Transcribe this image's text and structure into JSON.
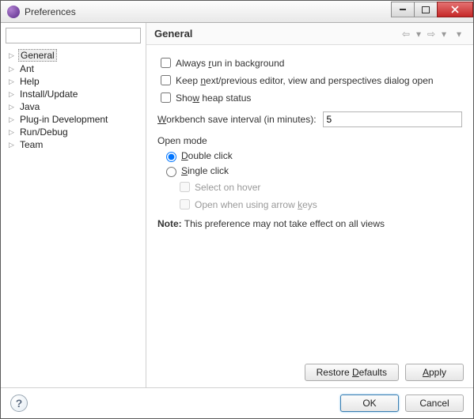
{
  "window": {
    "title": "Preferences"
  },
  "sidebar": {
    "filter_placeholder": "",
    "items": [
      {
        "label": "General",
        "expandable": true,
        "selected": true
      },
      {
        "label": "Ant",
        "expandable": true
      },
      {
        "label": "Help",
        "expandable": true
      },
      {
        "label": "Install/Update",
        "expandable": true
      },
      {
        "label": "Java",
        "expandable": true
      },
      {
        "label": "Plug-in Development",
        "expandable": true
      },
      {
        "label": "Run/Debug",
        "expandable": true
      },
      {
        "label": "Team",
        "expandable": true
      }
    ]
  },
  "page": {
    "title": "General",
    "checkboxes": {
      "run_bg": {
        "label_pre": "Always ",
        "mn": "r",
        "label_post": "un in background",
        "checked": false
      },
      "keep_editor": {
        "label_pre": "Keep ",
        "mn": "n",
        "label_post": "ext/previous editor, view and perspectives dialog open",
        "checked": false
      },
      "heap": {
        "label_pre": "Sho",
        "mn": "w",
        "label_post": " heap status",
        "checked": false
      }
    },
    "interval": {
      "label_pre": "",
      "mn": "W",
      "label_post": "orkbench save interval (in minutes):",
      "value": "5"
    },
    "open_mode": {
      "group": "Open mode",
      "double": {
        "mn": "D",
        "label": "ouble click",
        "checked": true
      },
      "single": {
        "mn": "S",
        "label": "ingle click",
        "checked": false
      },
      "hover": {
        "label": "Select on hover",
        "enabled": false
      },
      "arrow": {
        "label_pre": "Open when using arrow ",
        "mn": "k",
        "label_post": "eys",
        "enabled": false
      }
    },
    "note": {
      "bold": "Note:",
      "text": " This preference may not take effect on all views"
    },
    "buttons": {
      "restore_pre": "Restore ",
      "restore_mn": "D",
      "restore_post": "efaults",
      "apply_mn": "A",
      "apply_post": "pply"
    }
  },
  "footer": {
    "ok": "OK",
    "cancel": "Cancel"
  }
}
